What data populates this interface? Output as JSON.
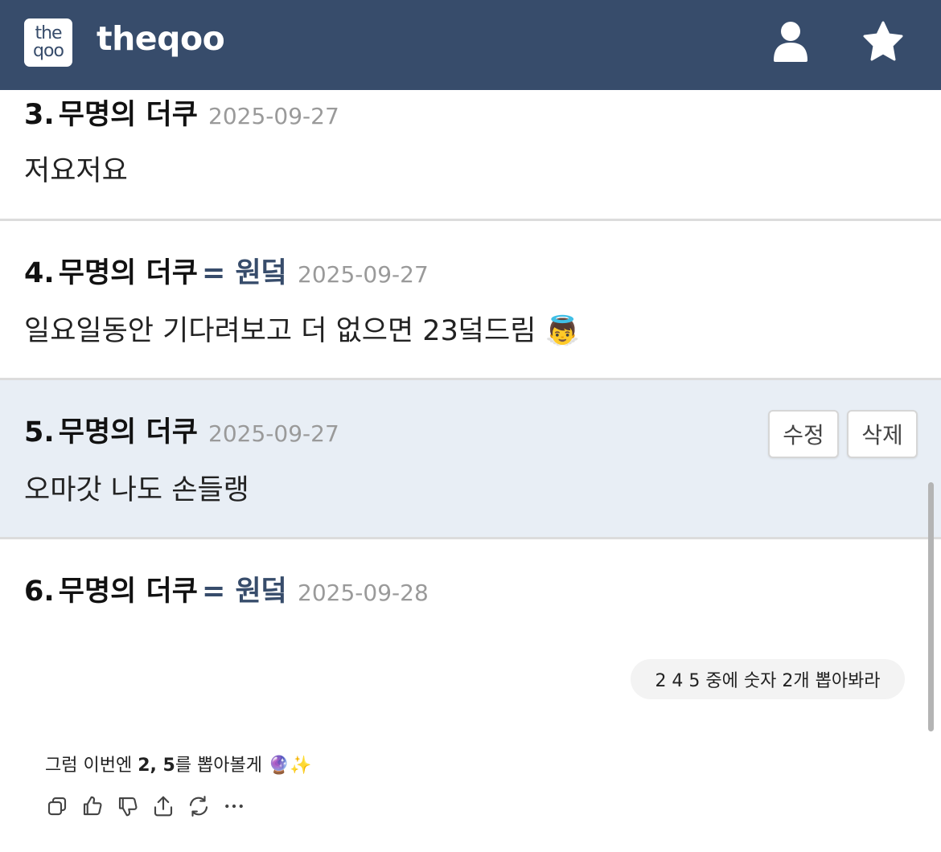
{
  "header": {
    "logo_top": "the",
    "logo_bottom": "qoo",
    "site_name": "theqoo",
    "user_icon": "user-icon",
    "star_icon": "star-icon",
    "bg_color": "#374c6b"
  },
  "comments": [
    {
      "num": "3.",
      "nick": "무명의 더쿠",
      "badge": "",
      "date": "2025-09-27",
      "text": "저요저요"
    },
    {
      "num": "4.",
      "nick": "무명의 더쿠",
      "badge": "= 원덬",
      "date": "2025-09-27",
      "text": "일요일동안 기다려보고 더 없으면 23덬드림",
      "emoji": "👼"
    },
    {
      "num": "5.",
      "nick": "무명의 더쿠",
      "badge": "",
      "date": "2025-09-27",
      "text": "오마갓 나도 손들랭",
      "edit_label": "수정",
      "delete_label": "삭제",
      "highlight_color": "#e8eef5"
    },
    {
      "num": "6.",
      "nick": "무명의 더쿠",
      "badge": "= 원덬",
      "date": "2025-09-28",
      "text": ""
    }
  ],
  "chat": {
    "user_message": "2 4 5 중에 숫자 2개 뽑아봐라",
    "reply_prefix": "그럼 이번엔 ",
    "reply_bold": "2, 5",
    "reply_suffix": "를 뽑아볼게 ",
    "reply_emoji": "🔮✨",
    "actions": [
      "copy-icon",
      "thumbs-up-icon",
      "thumbs-down-icon",
      "share-icon",
      "regenerate-icon",
      "more-icon"
    ]
  }
}
